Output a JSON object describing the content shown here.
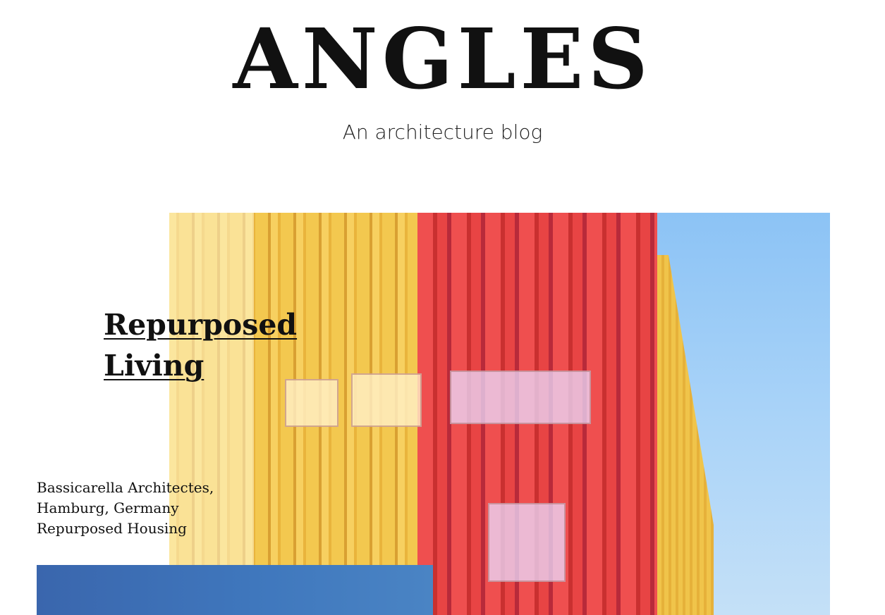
{
  "header": {
    "logo": "ANGLES",
    "tagline": "An architecture blog"
  },
  "post": {
    "title_line1": "Repurposed",
    "title_line2": "Living",
    "meta": [
      "Bassicarella Architectes,",
      "Hamburg, Germany",
      "Repurposed Housing"
    ]
  },
  "colors": {
    "text": "#111111",
    "facade_yellow": "#f3c84f",
    "facade_red": "#e84444",
    "sky": "#8cc3f5",
    "secondary_blue": "#3f77bd"
  }
}
